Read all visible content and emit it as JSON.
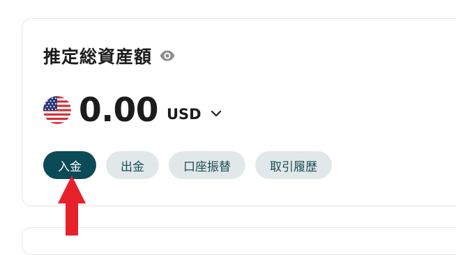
{
  "summary": {
    "title": "推定総資産額",
    "balance": {
      "amount": "0.00",
      "currency": "USD"
    }
  },
  "actions": [
    {
      "label": "入金"
    },
    {
      "label": "出金"
    },
    {
      "label": "口座振替"
    },
    {
      "label": "取引履歴"
    }
  ],
  "icons": {
    "visibility": "eye-icon",
    "flag": "us-flag-icon",
    "currency_select": "chevron-down-icon",
    "annotation": "arrow-up-icon"
  },
  "colors": {
    "primary_button": "#0b4a57",
    "secondary_button": "#e1e8e9",
    "annotation_arrow": "#e8202a"
  }
}
